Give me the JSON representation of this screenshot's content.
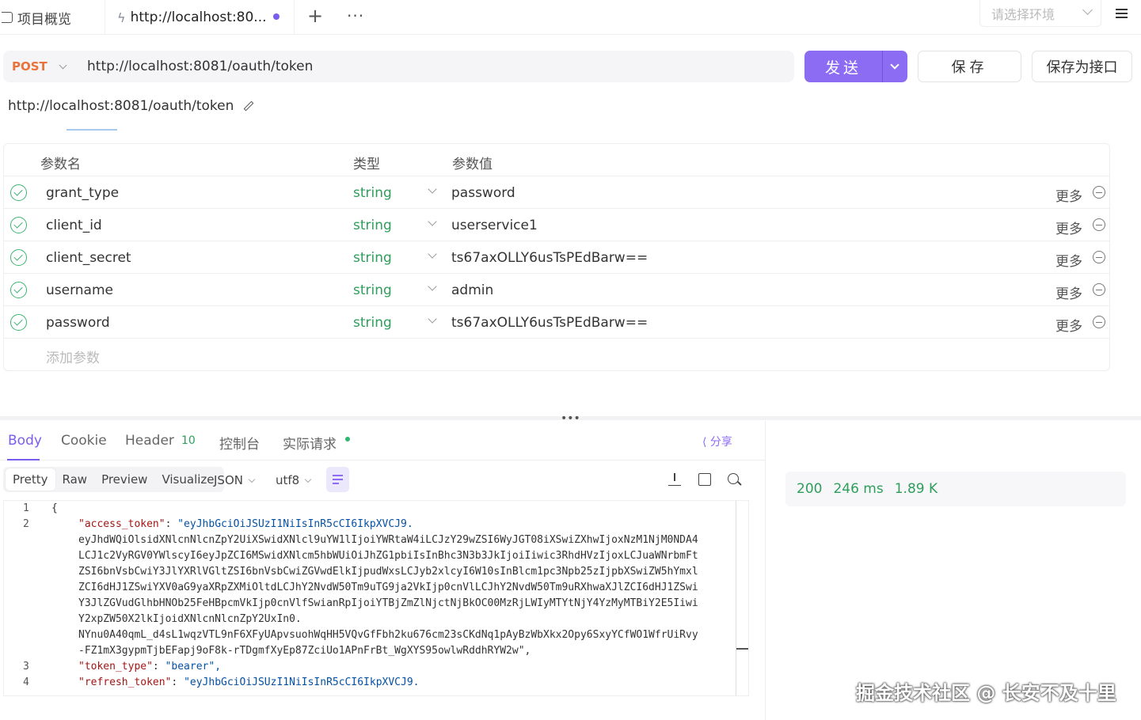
{
  "tabs": {
    "overview": "项目概览",
    "active": "http://localhost:80...",
    "add": "+",
    "more": "···"
  },
  "env": {
    "placeholder": "请选择环境"
  },
  "request": {
    "method": "POST",
    "url": "http://localhost:8081/oauth/token",
    "send": "发送",
    "save": "保存",
    "save_as_api": "保存为接口",
    "title": "http://localhost:8081/oauth/token"
  },
  "params": {
    "headers": {
      "name": "参数名",
      "type": "类型",
      "value": "参数值"
    },
    "rows": [
      {
        "name": "grant_type",
        "type": "string",
        "value": "password",
        "more": "更多"
      },
      {
        "name": "client_id",
        "type": "string",
        "value": "userservice1",
        "more": "更多"
      },
      {
        "name": "client_secret",
        "type": "string",
        "value": "ts67axOLLY6usTsPEdBarw==",
        "more": "更多"
      },
      {
        "name": "username",
        "type": "string",
        "value": "admin",
        "more": "更多"
      },
      {
        "name": "password",
        "type": "string",
        "value": "ts67axOLLY6usTsPEdBarw==",
        "more": "更多"
      }
    ],
    "add_placeholder": "添加参数"
  },
  "response": {
    "tabs": {
      "body": "Body",
      "cookie": "Cookie",
      "header": "Header",
      "header_count": "10",
      "console": "控制台",
      "actual": "实际请求"
    },
    "share": "分享",
    "views": [
      "Pretty",
      "Raw",
      "Preview",
      "Visualize"
    ],
    "format": "JSON",
    "encoding": "utf8",
    "code": [
      {
        "ln": "1",
        "text": "{"
      },
      {
        "ln": "2",
        "key": "\"access_token\"",
        "val": "\"eyJhbGciOiJSUzI1NiIsInR5cCI6IkpXVCJ9."
      },
      {
        "ln": "",
        "val": "eyJhdWQiOlsidXNlcnNlcnZpY2UiXSwidXNlcl9uYW1lIjoiYWRtaW4iLCJzY29wZSI6WyJGT08iXSwiZXhwIjoxNzM1NjM0NDA4"
      },
      {
        "ln": "",
        "val": "LCJ1c2VyRGV0YWlscyI6eyJpZCI6MSwidXNlcm5hbWUiOiJhZG1pbiIsInBhc3N3b3JkIjoiIiwic3RhdHVzIjoxLCJuaWNrbmFt"
      },
      {
        "ln": "",
        "val": "ZSI6bnVsbCwiY3JlYXRlVGltZSI6bnVsbCwiZGVwdElkIjpudWxsLCJyb2xlcyI6W10sInBlcm1pc3Npb25zIjpbXSwiZW5hYmxl"
      },
      {
        "ln": "",
        "val": "ZCI6dHJ1ZSwiYXV0aG9yaXRpZXMiOltdLCJhY2NvdW50Tm9uTG9ja2VkIjp0cnVlLCJhY2NvdW50Tm9uRXhwaXJlZCI6dHJ1ZSwi"
      },
      {
        "ln": "",
        "val": "Y3JlZGVudGlhbHNOb25FeHBpcmVkIjp0cnVlfSwianRpIjoiYTBjZmZlNjctNjBkOC00MzRjLWIyMTYtNjY4YzMyMTBiY2E5Iiwi"
      },
      {
        "ln": "",
        "val": "Y2xpZW50X2lkIjoidXNlcnNlcnZpY2UxIn0."
      },
      {
        "ln": "",
        "val": "NYnu0A40qmL_d4sL1wqzVTL9nF6XFyUApvsuohWqHH5VQvGfFbh2ku676cm23sCKdNq1pAyBzWbXkx2Opy6SxyYCfWO1WfrUiRvy"
      },
      {
        "ln": "",
        "val": "-FZ1mX3gypmTjbEFapj9oF8k-rTDgmfXyEp87ZciUo1APnFrBt_WgXYS95owlwRddhRYW2w\","
      },
      {
        "ln": "3",
        "key": "\"token_type\"",
        "val": "\"bearer\","
      },
      {
        "ln": "4",
        "key": "\"refresh_token\"",
        "val": "\"eyJhbGciOiJSUzI1NiIsInR5cCI6IkpXVCJ9."
      }
    ],
    "status": {
      "code": "200",
      "time": "246 ms",
      "size": "1.89 K"
    }
  },
  "watermark": "掘金技术社区 @ 长安不及十里"
}
